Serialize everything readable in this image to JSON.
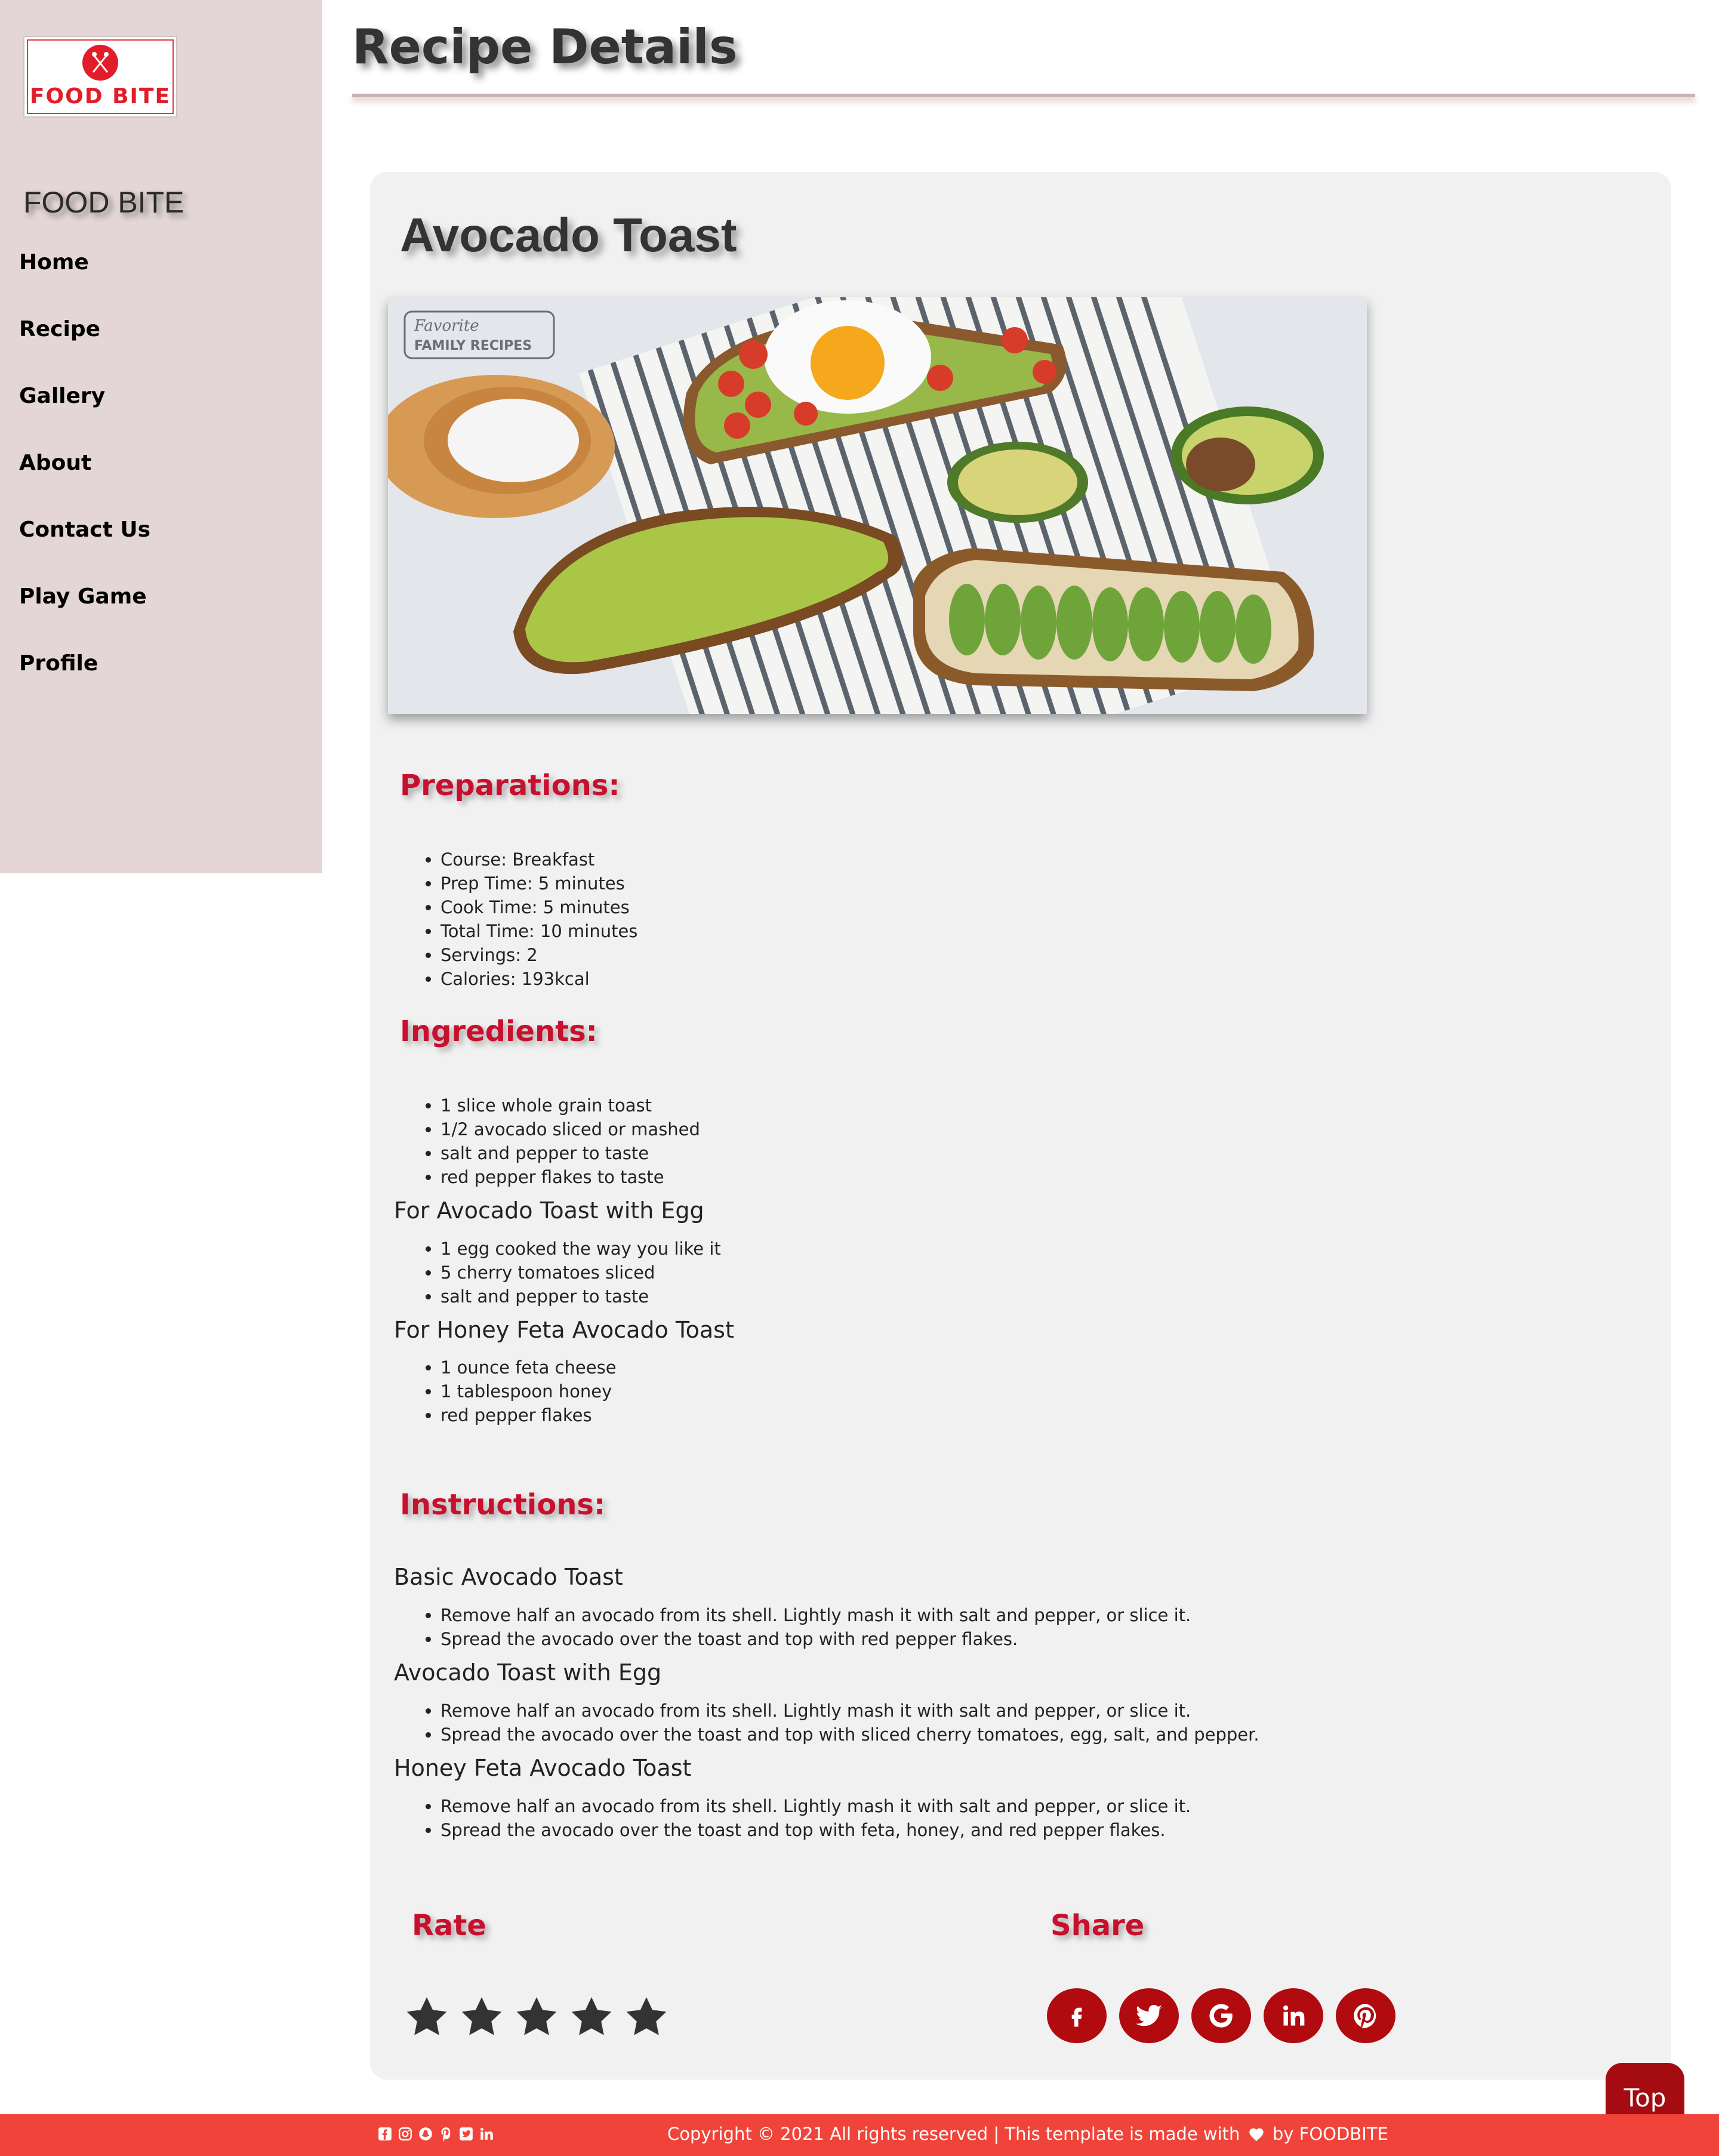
{
  "sidebar": {
    "logo_text": "FOOD BITE",
    "brand": "FOOD BITE",
    "items": [
      {
        "label": "Home"
      },
      {
        "label": "Recipe"
      },
      {
        "label": "Gallery"
      },
      {
        "label": "About"
      },
      {
        "label": "Contact Us"
      },
      {
        "label": "Play Game"
      },
      {
        "label": "Profile"
      }
    ]
  },
  "header": {
    "title": "Recipe Details"
  },
  "recipe": {
    "title": "Avocado Toast",
    "photo_caption": "Favorite FAMILY RECIPES",
    "preparations": {
      "heading": "Preparations:",
      "items": [
        "Course: Breakfast",
        "Prep Time: 5 minutes",
        "Cook Time: 5 minutes",
        "Total Time: 10 minutes",
        "Servings: 2",
        "Calories: 193kcal"
      ]
    },
    "ingredients": {
      "heading": "Ingredients:",
      "base": [
        "1 slice whole grain toast",
        "1/2 avocado sliced or mashed",
        "salt and pepper to taste",
        "red pepper flakes to taste"
      ],
      "egg_heading": "For Avocado Toast with Egg",
      "egg": [
        "1 egg cooked the way you like it",
        "5 cherry tomatoes sliced",
        "salt and pepper to taste"
      ],
      "feta_heading": "For Honey Feta Avocado Toast",
      "feta": [
        "1 ounce feta cheese",
        "1 tablespoon honey",
        "red pepper flakes"
      ]
    },
    "instructions": {
      "heading": "Instructions:",
      "basic_heading": "Basic Avocado Toast",
      "basic": [
        "Remove half an avocado from its shell. Lightly mash it with salt and pepper, or slice it.",
        "Spread the avocado over the toast and top with red pepper flakes."
      ],
      "egg_heading": "Avocado Toast with Egg",
      "egg": [
        "Remove half an avocado from its shell. Lightly mash it with salt and pepper, or slice it.",
        "Spread the avocado over the toast and top with sliced cherry tomatoes, egg, salt, and pepper."
      ],
      "feta_heading": "Honey Feta Avocado Toast",
      "feta": [
        "Remove half an avocado from its shell. Lightly mash it with salt and pepper, or slice it.",
        "Spread the avocado over the toast and top with feta, honey, and red pepper flakes."
      ]
    }
  },
  "rate": {
    "heading": "Rate",
    "stars_total": 5
  },
  "share": {
    "heading": "Share",
    "icons": [
      "facebook-icon",
      "twitter-icon",
      "google-icon",
      "linkedin-icon",
      "pinterest-icon"
    ]
  },
  "top_button": "Top",
  "footer": {
    "social_icons": [
      "facebook-icon",
      "instagram-icon",
      "snapchat-icon",
      "pinterest-icon",
      "twitter-icon",
      "linkedin-icon"
    ],
    "copyright_before": "Copyright © 2021 All rights reserved | This template is made with",
    "copyright_after": "by FOODBITE"
  },
  "colors": {
    "sidebar_bg": "#e4d6d7",
    "accent_red": "#c8102e",
    "button_red": "#b10a0f",
    "footer_bg": "#f0443b",
    "card_bg": "#f1f1f1"
  }
}
